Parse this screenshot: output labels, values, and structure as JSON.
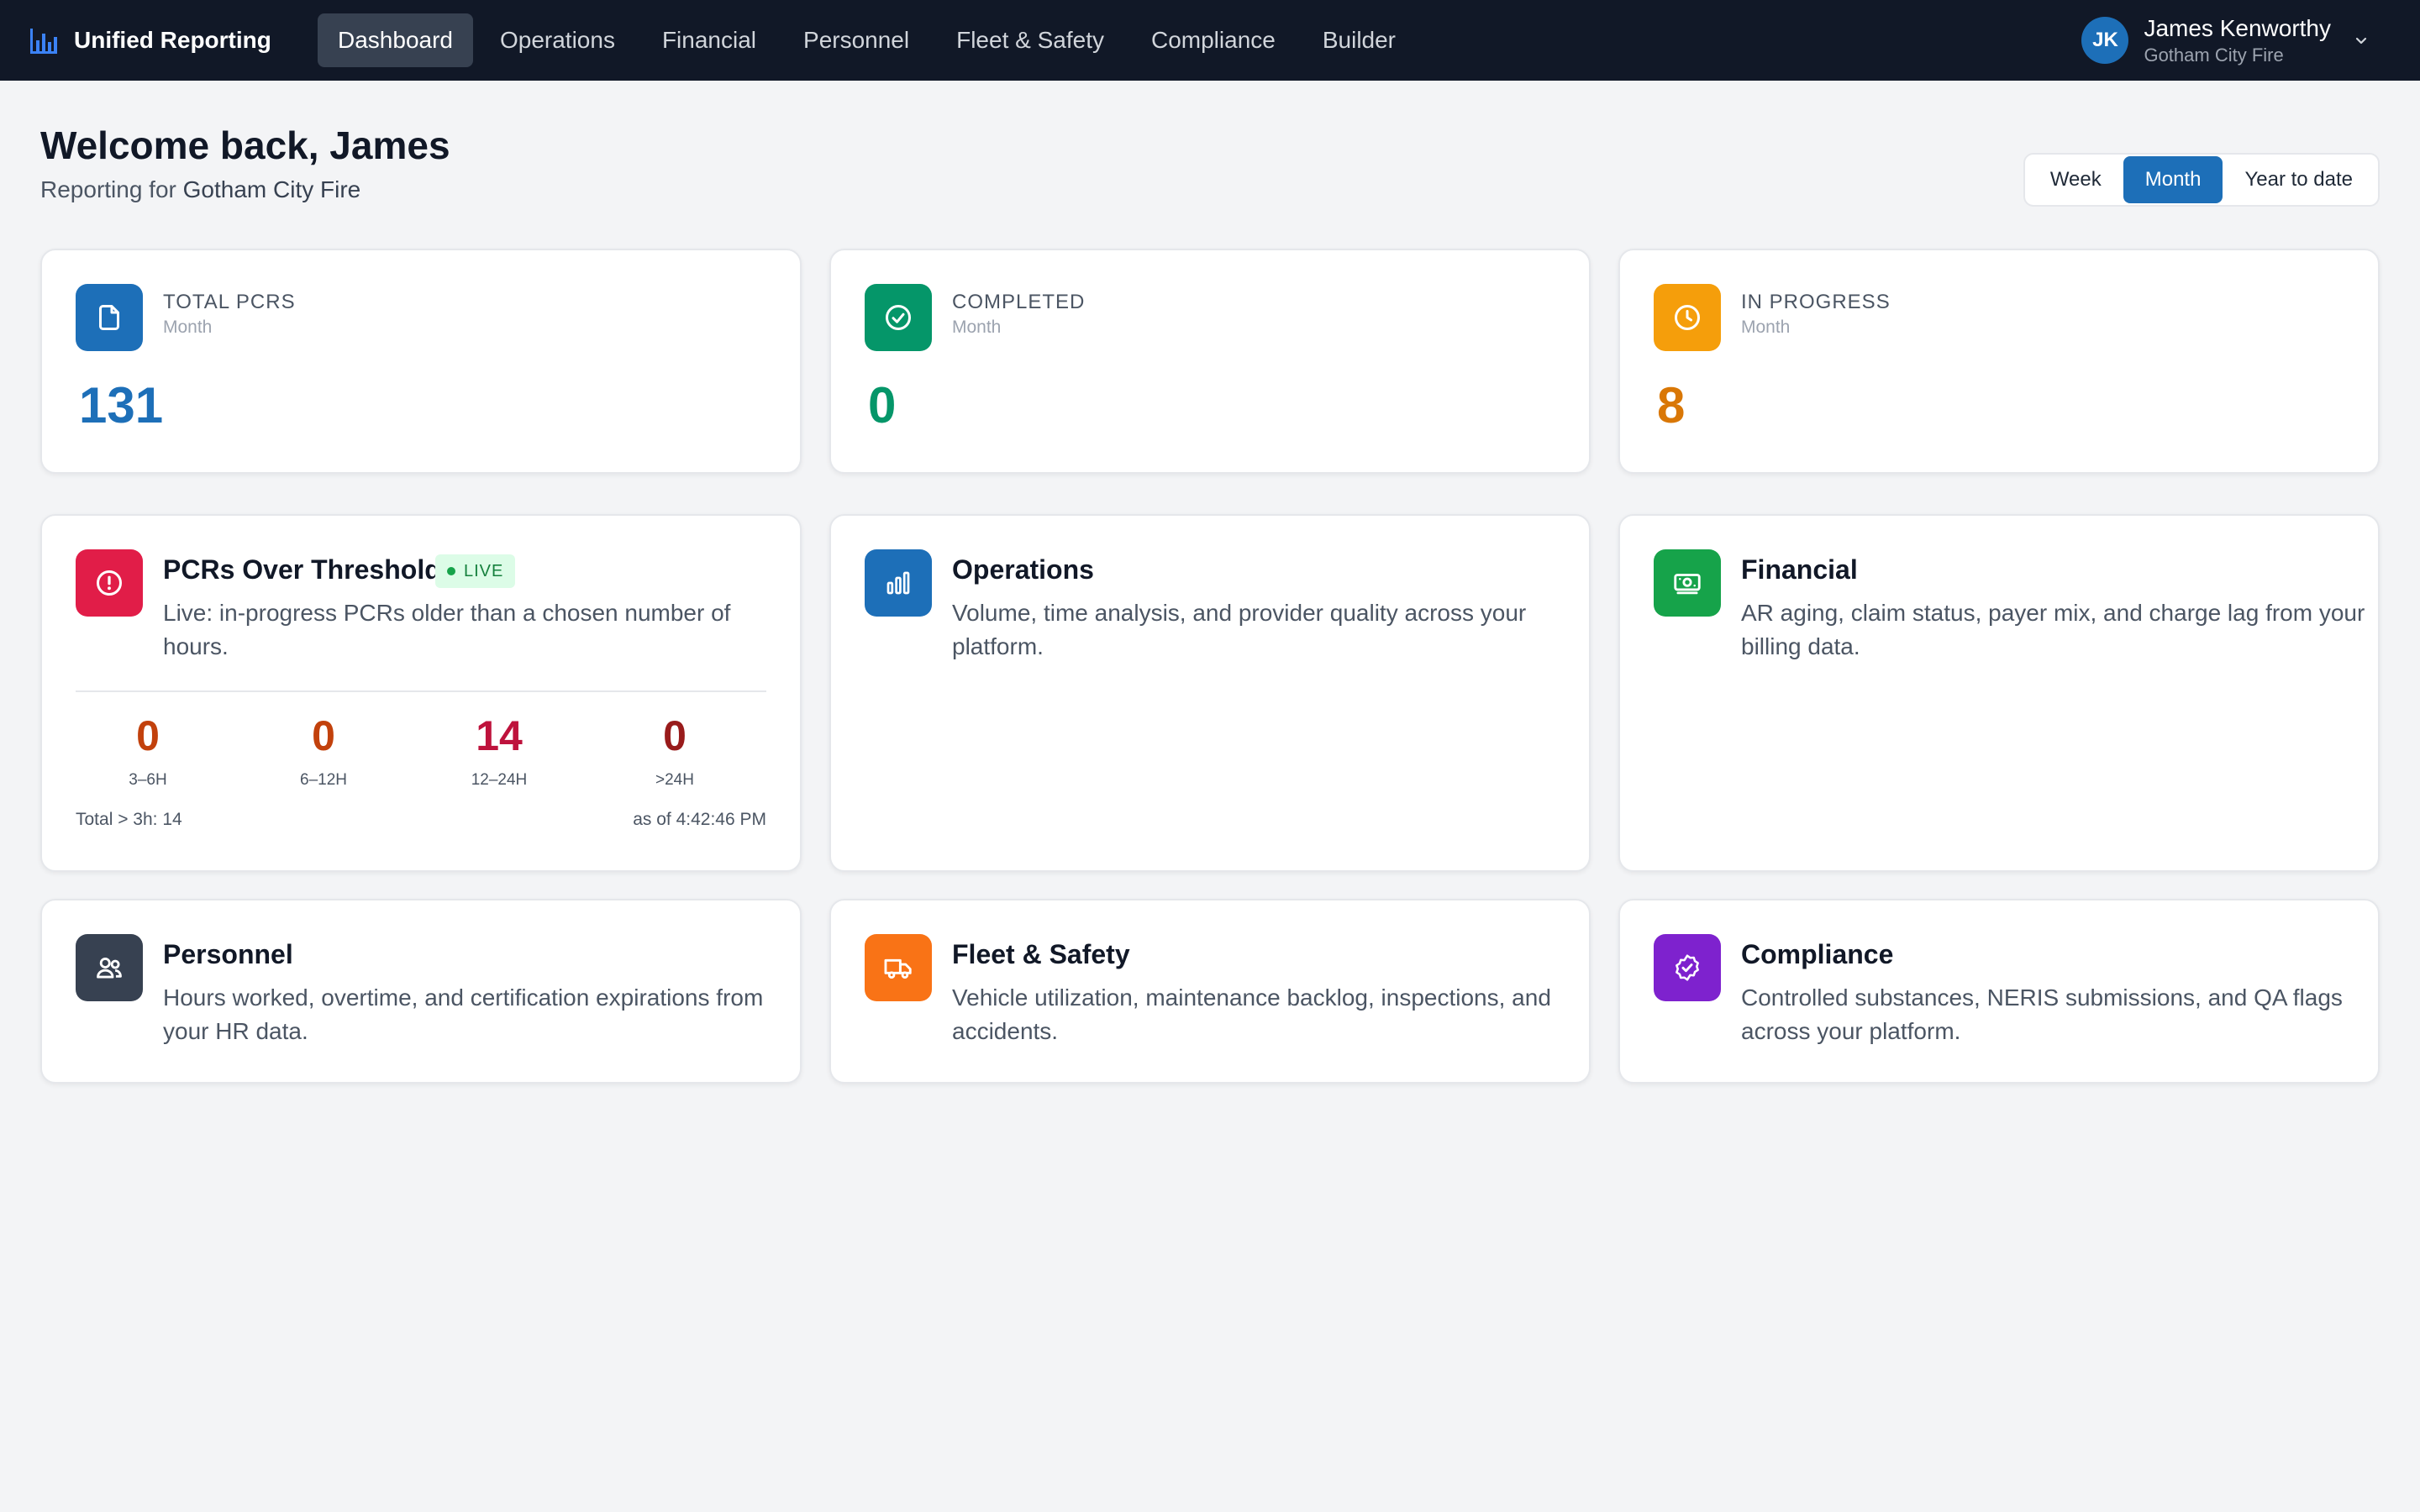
{
  "app": {
    "title": "Unified Reporting"
  },
  "nav": [
    {
      "label": "Dashboard",
      "active": true
    },
    {
      "label": "Operations"
    },
    {
      "label": "Financial"
    },
    {
      "label": "Personnel"
    },
    {
      "label": "Fleet & Safety"
    },
    {
      "label": "Compliance"
    },
    {
      "label": "Builder"
    }
  ],
  "user": {
    "initials": "JK",
    "name": "James Kenworthy",
    "org": "Gotham City Fire"
  },
  "header": {
    "welcome": "Welcome back, James",
    "reporting_prefix": "Reporting for",
    "org": "Gotham City Fire"
  },
  "range": {
    "options": [
      "Week",
      "Month",
      "Year to date"
    ],
    "selected": "Month"
  },
  "kpis": [
    {
      "label": "TOTAL PCRS",
      "period": "Month",
      "value": "131",
      "color": "#1d6fb8",
      "icon": "document-icon"
    },
    {
      "label": "COMPLETED",
      "period": "Month",
      "value": "0",
      "color": "#059669",
      "icon": "check-circle-icon"
    },
    {
      "label": "IN PROGRESS",
      "period": "Month",
      "value": "8",
      "color": "#d97706",
      "icon": "clock-icon"
    }
  ],
  "threshold": {
    "title": "PCRs Over Threshold",
    "badge": "LIVE",
    "description": "Live: in-progress PCRs older than a chosen number of hours.",
    "buckets": [
      {
        "value": "0",
        "label": "3–6H",
        "color": "#c2410c"
      },
      {
        "value": "0",
        "label": "6–12H",
        "color": "#c2410c"
      },
      {
        "value": "14",
        "label": "12–24H",
        "color": "#be123c"
      },
      {
        "value": "0",
        "label": ">24H",
        "color": "#991b1b"
      }
    ],
    "total": "Total > 3h: 14",
    "as_of": "as of 4:42:46 PM"
  },
  "sections": [
    {
      "title": "Operations",
      "description": "Volume, time analysis, and provider quality across your platform.",
      "color": "#1d6fb8",
      "icon": "bar-chart-icon"
    },
    {
      "title": "Financial",
      "description": "AR aging, claim status, payer mix, and charge lag from your billing data.",
      "color": "#16a34a",
      "icon": "money-icon"
    },
    {
      "title": "Personnel",
      "description": "Hours worked, overtime, and certification expirations from your HR data.",
      "color": "#374151",
      "icon": "users-icon"
    },
    {
      "title": "Fleet & Safety",
      "description": "Vehicle utilization, maintenance backlog, inspections, and accidents.",
      "color": "#f97316",
      "icon": "truck-icon"
    },
    {
      "title": "Compliance",
      "description": "Controlled substances, NERIS submissions, and QA flags across your platform.",
      "color": "#7e22ce",
      "icon": "badge-check-icon"
    }
  ],
  "colors": {
    "nav_bg": "#111827",
    "page_bg": "#f3f4f6",
    "accent": "#1d6fb8",
    "alert": "#e11d48"
  }
}
